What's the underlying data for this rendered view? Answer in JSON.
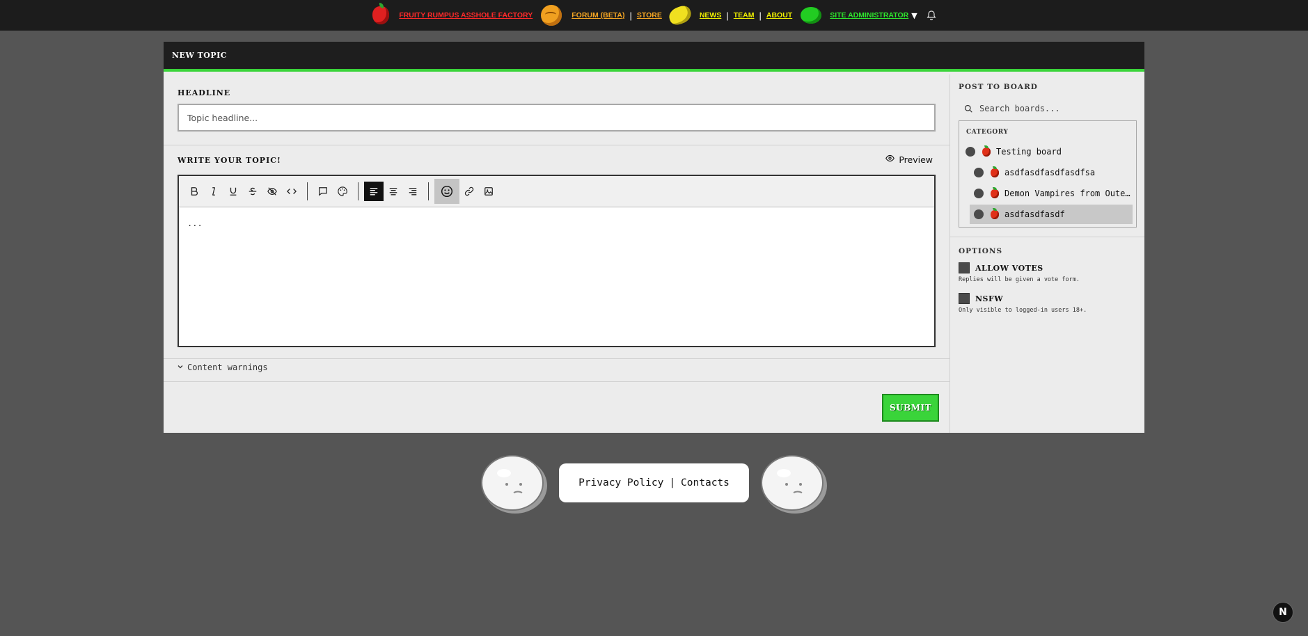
{
  "nav": {
    "brand": "FRUITY RUMPUS ASSHOLE FACTORY",
    "links": [
      "FORUM (BETA)",
      "STORE",
      "NEWS",
      "TEAM",
      "ABOUT"
    ],
    "separators": [
      "|",
      "|",
      "|"
    ],
    "user": "SITE ADMINISTRATOR",
    "caret": "▼",
    "colors": {
      "brand": "#ff2a2a",
      "orange_links": "#f5a623",
      "yellow_links": "#f0f000",
      "user": "#2ee82e"
    },
    "icons": [
      "apple-icon",
      "orange-icon",
      "lemon-icon",
      "lime-icon",
      "bell-icon"
    ]
  },
  "page": {
    "title": "NEW TOPIC",
    "accent": "#3ad43a"
  },
  "form": {
    "headline_label": "HEADLINE",
    "headline_placeholder": "Topic headline...",
    "write_label": "WRITE YOUR TOPIC!",
    "preview_label": "Preview",
    "editor_text": "...",
    "toolbar_icons": [
      "bold-icon",
      "italic-icon",
      "underline-icon",
      "strikethrough-icon",
      "spoiler-icon",
      "code-icon",
      "quote-icon",
      "color-icon",
      "align-left-icon",
      "align-center-icon",
      "align-right-icon",
      "emoji-icon",
      "link-icon",
      "image-icon"
    ],
    "content_warnings_label": "Content warnings",
    "submit_label": "SUBMIT"
  },
  "sidebar": {
    "post_to_board_label": "POST TO BOARD",
    "search_placeholder": "Search boards...",
    "category_label": "CATEGORY",
    "boards": [
      {
        "label": "Testing board",
        "selected": false
      },
      {
        "label": "asdfasdfasdfasdfsa",
        "selected": false
      },
      {
        "label": "Demon Vampires from Outer Space",
        "selected": false
      },
      {
        "label": "asdfasdfasdf",
        "selected": true
      }
    ],
    "options_label": "OPTIONS",
    "options": [
      {
        "title": "ALLOW VOTES",
        "description": "Replies will be given a vote form.",
        "checked": false
      },
      {
        "title": "NSFW",
        "description": "Only visible to logged-in users 18+.",
        "checked": false
      }
    ]
  },
  "footer": {
    "privacy": "Privacy Policy",
    "separator": "|",
    "contacts": "Contacts",
    "badge": "N"
  }
}
